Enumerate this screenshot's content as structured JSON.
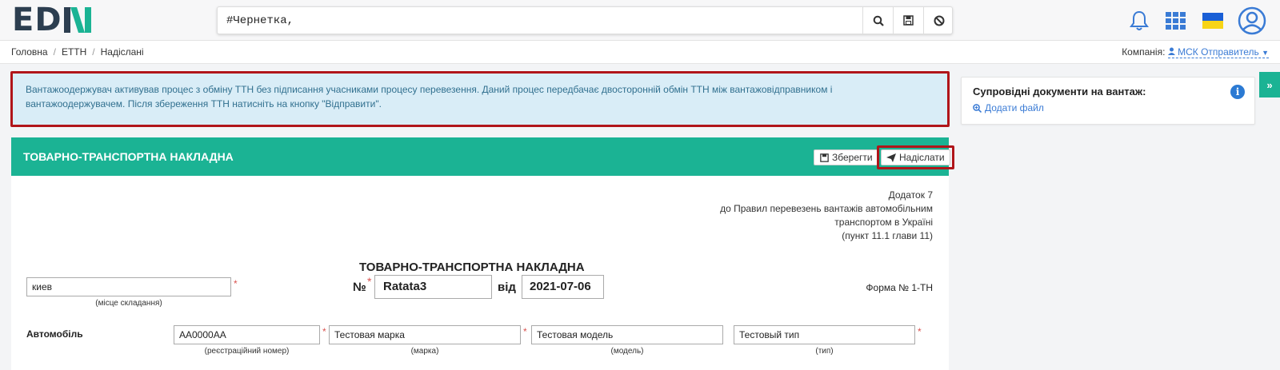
{
  "header": {
    "logo_left": "ED",
    "logo_right": "NI",
    "search_value": "#Чернетка,",
    "icons": [
      "search-icon",
      "save-icon",
      "ban-icon",
      "bell-icon",
      "apps-grid-icon",
      "ukraine-flag-icon",
      "user-avatar-icon"
    ],
    "colors": {
      "logo_dark": "#2c3e50",
      "logo_green": "#1bb394"
    }
  },
  "breadcrumb": {
    "items": [
      "Головна",
      "ЕТТН",
      "Надіслані"
    ]
  },
  "company": {
    "label": "Компанія:",
    "value": "МСК Отправитель"
  },
  "alert": {
    "text": "Вантажоодержувач активував процес з обміну ТТН без підписання учасниками процесу перевезення. Даний процес передбачає двосторонній обмін ТТН між вантажовідправником і вантажоодержувачем. Після збереження ТТН натисніть на кнопку \"Відправити\"."
  },
  "panel": {
    "title": "ТОВАРНО-ТРАНСПОРТНА НАКЛАДНА",
    "save_label": "Зберегти",
    "send_label": "Надіслати",
    "accent": "#1bb394"
  },
  "form": {
    "appendix": [
      "Додаток 7",
      "до Правил перевезень вантажів автомобільним",
      "транспортом в Україні",
      "(пункт 11.1 глави 11)"
    ],
    "doc_title": "ТОВАРНО-ТРАНСПОРТНА НАКЛАДНА",
    "place_value": "киев",
    "place_caption": "(місце складання)",
    "number_label": "№",
    "number_value": "Ratata3",
    "date_label": "від",
    "date_value": "2021-07-06",
    "form_no": "Форма № 1-ТН",
    "car_label": "Автомобіль",
    "car": {
      "reg_value": "АА0000АА",
      "reg_caption": "(реєстраційний номер)",
      "brand_value": "Тестовая марка",
      "brand_caption": "(марка)",
      "model_value": "Тестовая модель",
      "model_caption": "(модель)",
      "type_value": "Тестовый тип",
      "type_caption": "(тип)"
    }
  },
  "sidebar": {
    "heading": "Супровідні документи на вантаж:",
    "add_file": "Додати файл",
    "collapse": "»"
  }
}
